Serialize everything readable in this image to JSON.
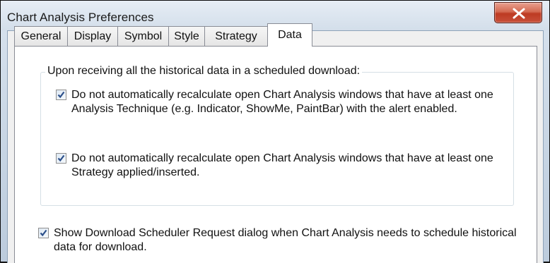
{
  "window": {
    "title": "Chart Analysis Preferences"
  },
  "tabs": [
    {
      "label": "General",
      "active": false
    },
    {
      "label": "Display",
      "active": false
    },
    {
      "label": "Symbol",
      "active": false
    },
    {
      "label": "Style",
      "active": false
    },
    {
      "label": "Strategy",
      "active": false
    },
    {
      "label": "Data",
      "active": true
    }
  ],
  "data_tab": {
    "group_label": "Upon receiving all the historical data in a scheduled download:",
    "options": [
      {
        "checked": true,
        "label": "Do not automatically recalculate open Chart Analysis windows that have at least one Analysis Technique (e.g. Indicator, ShowMe, PaintBar) with the alert enabled."
      },
      {
        "checked": true,
        "label": "Do not automatically recalculate open Chart Analysis windows that have at least one Strategy applied/inserted."
      }
    ],
    "scheduler_option": {
      "checked": true,
      "label": "Show Download Scheduler Request dialog when Chart Analysis needs to schedule historical data for download."
    }
  },
  "colors": {
    "close_button": "#c8503a",
    "check_mark": "#2b4f8a"
  },
  "icons": {
    "close": "close-x-icon",
    "check": "checkmark-icon"
  }
}
